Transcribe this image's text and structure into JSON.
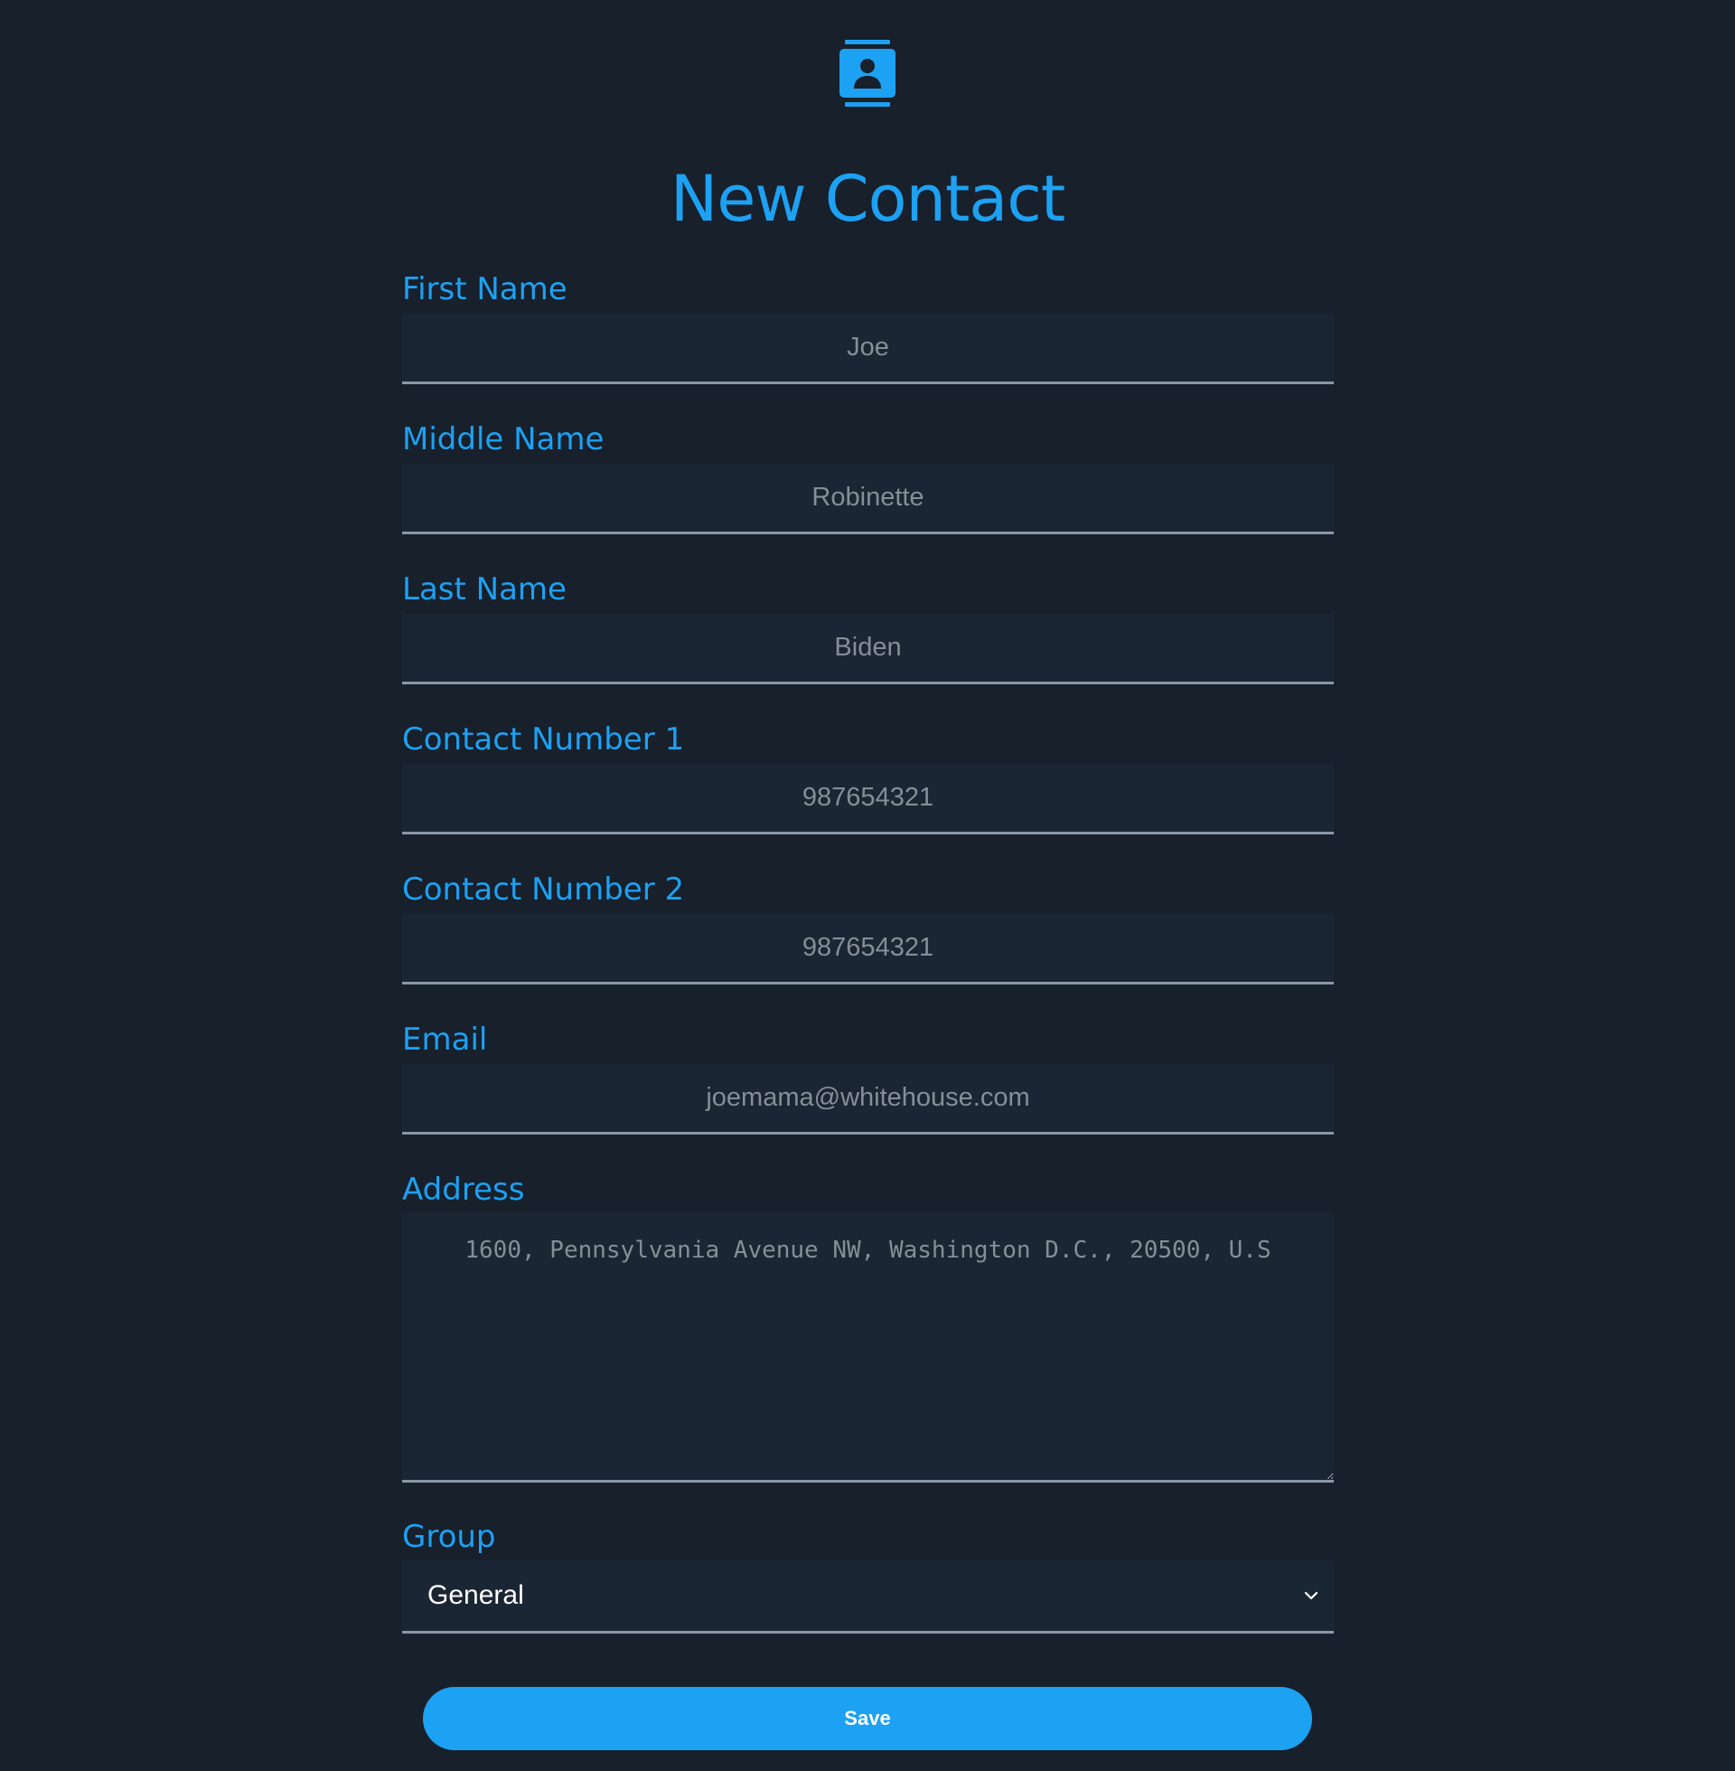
{
  "header": {
    "icon": "contact-book-icon",
    "title": "New Contact"
  },
  "colors": {
    "background": "#17202b",
    "input_background": "#1a2634",
    "accent": "#1da1f2",
    "border": "#8a97a6",
    "placeholder": "#868e96",
    "white": "#ffffff"
  },
  "form": {
    "first_name": {
      "label": "First Name",
      "placeholder": "Joe"
    },
    "middle_name": {
      "label": "Middle Name",
      "placeholder": "Robinette"
    },
    "last_name": {
      "label": "Last Name",
      "placeholder": "Biden"
    },
    "contact_number_1": {
      "label": "Contact Number 1",
      "placeholder": "987654321"
    },
    "contact_number_2": {
      "label": "Contact Number 2",
      "placeholder": "987654321"
    },
    "email": {
      "label": "Email",
      "placeholder": "joemama@whitehouse.com"
    },
    "address": {
      "label": "Address",
      "placeholder": "1600, Pennsylvania Avenue NW, Washington D.C., 20500, U.S"
    },
    "group": {
      "label": "Group",
      "selected": "General",
      "icon": "chevron-down-icon"
    },
    "save_label": "Save"
  }
}
